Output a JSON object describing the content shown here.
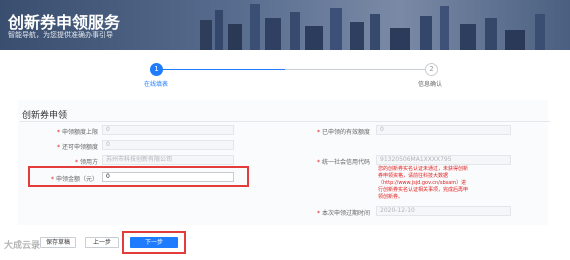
{
  "banner": {
    "title": "创新券申领服务",
    "subtitle": "智能导航，为您提供准确办事引导"
  },
  "steps": [
    {
      "index": "1",
      "label": "在线填表",
      "state": "active"
    },
    {
      "index": "2",
      "label": "信息确认",
      "state": "idle"
    }
  ],
  "form": {
    "title": "创新券申领",
    "fields": {
      "limit": {
        "label": "申领额度上限",
        "value": "0"
      },
      "remaining": {
        "label": "还可申领额度",
        "value": "0"
      },
      "applicant": {
        "label": "领用方",
        "value": "苏州市科技创新有限公司"
      },
      "amount": {
        "label": "申领金额（元）",
        "value": "0"
      },
      "valid_amount": {
        "label": "已申领的有效额度",
        "value": "0"
      },
      "credit_code": {
        "label": "统一社会信用代码",
        "value": "91320506MA1XXXX795"
      },
      "expire": {
        "label": "本次申领过期时间",
        "value": "2020-12-10"
      }
    },
    "warning": "您的创新券实名认证未通过，未获得创新券申领资格，请前往科技大数据（http://www.jsjd.gov.cn/sbsam）进行创新券实名认证相关事项，完成后再申领创新券。"
  },
  "buttons": {
    "save": "保存草稿",
    "prev": "上一步",
    "next": "下一步"
  },
  "watermark": "大成云录"
}
